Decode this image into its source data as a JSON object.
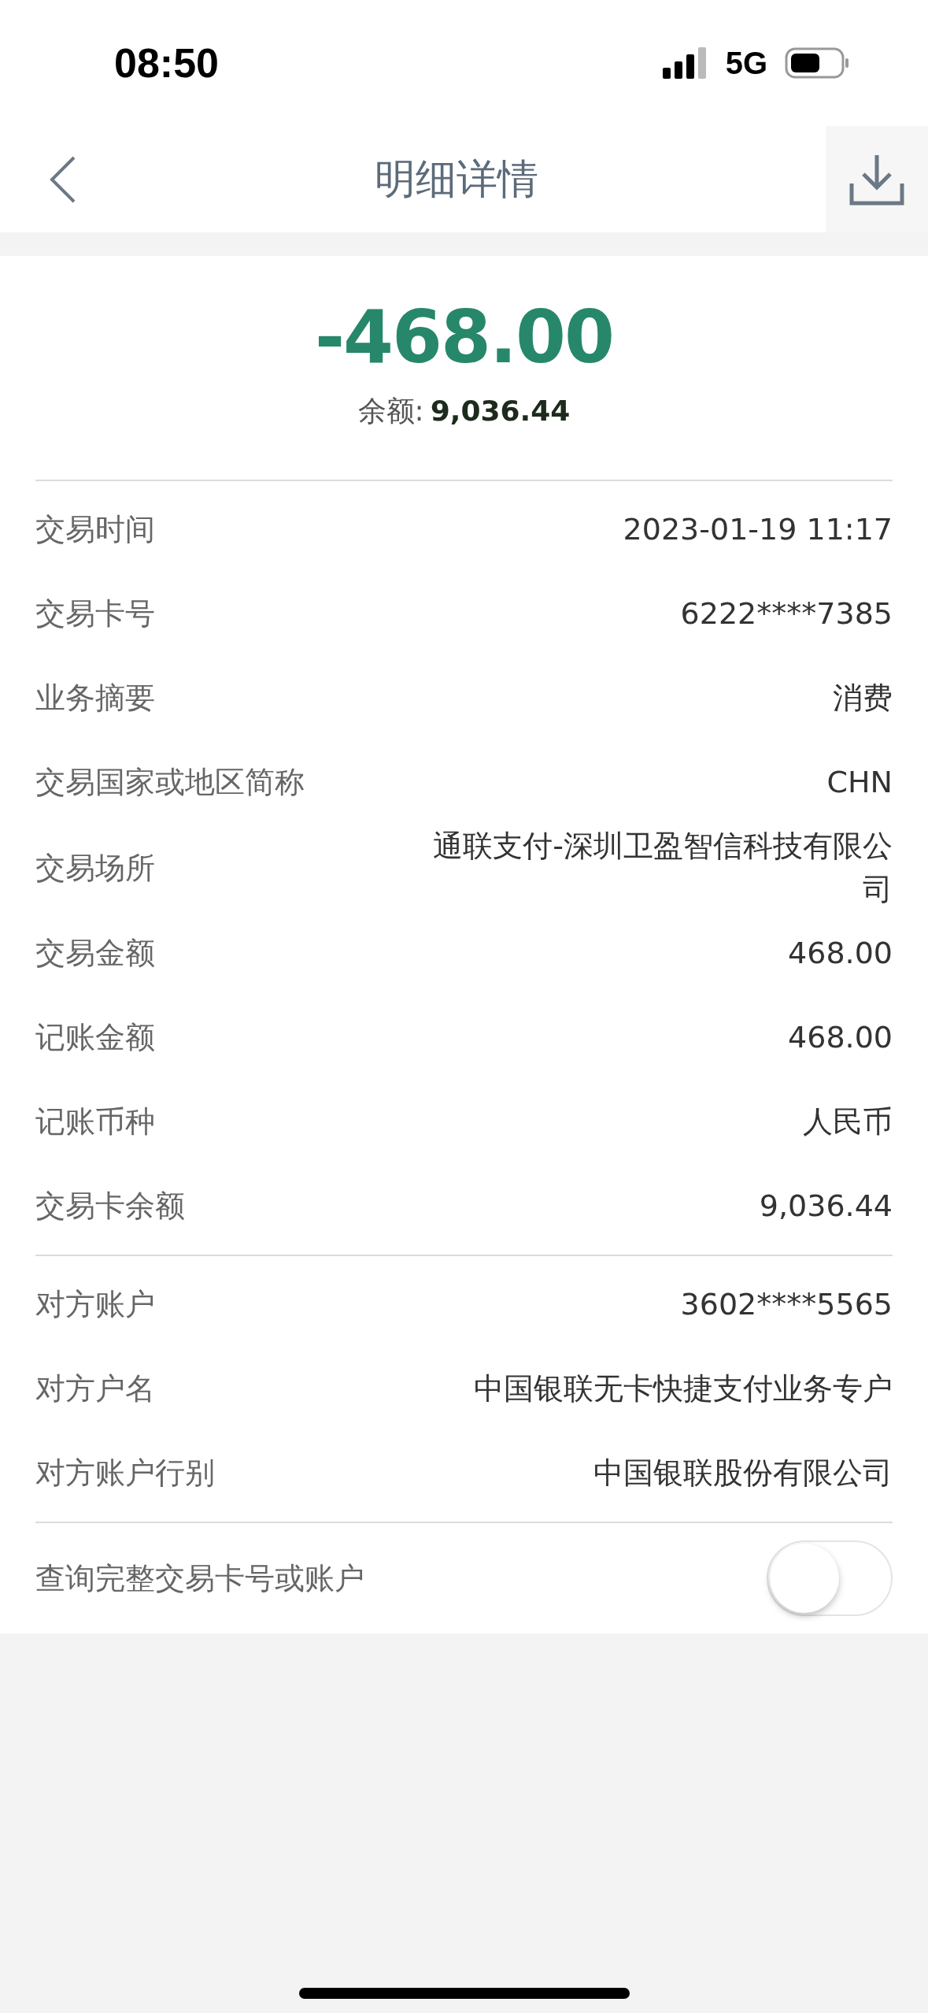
{
  "status_bar": {
    "time": "08:50",
    "network": "5G"
  },
  "nav": {
    "title": "明细详情"
  },
  "summary": {
    "amount": "-468.00",
    "balance_label": "余额:",
    "balance": "9,036.44"
  },
  "sections": [
    {
      "rows": [
        {
          "label": "交易时间",
          "value": "2023-01-19 11:17"
        },
        {
          "label": "交易卡号",
          "value": "6222****7385"
        },
        {
          "label": "业务摘要",
          "value": "消费"
        },
        {
          "label": "交易国家或地区简称",
          "value": "CHN"
        },
        {
          "label": "交易场所",
          "value": "通联支付-深圳卫盈智信科技有限公司"
        },
        {
          "label": "交易金额",
          "value": "468.00"
        },
        {
          "label": "记账金额",
          "value": "468.00"
        },
        {
          "label": "记账币种",
          "value": "人民币"
        },
        {
          "label": "交易卡余额",
          "value": "9,036.44"
        }
      ]
    },
    {
      "rows": [
        {
          "label": "对方账户",
          "value": "3602****5565"
        },
        {
          "label": "对方户名",
          "value": "中国银联无卡快捷支付业务专户"
        },
        {
          "label": "对方账户行别",
          "value": "中国银联股份有限公司"
        }
      ]
    }
  ],
  "toggle_row": {
    "label": "查询完整交易卡号或账户",
    "on": false
  }
}
